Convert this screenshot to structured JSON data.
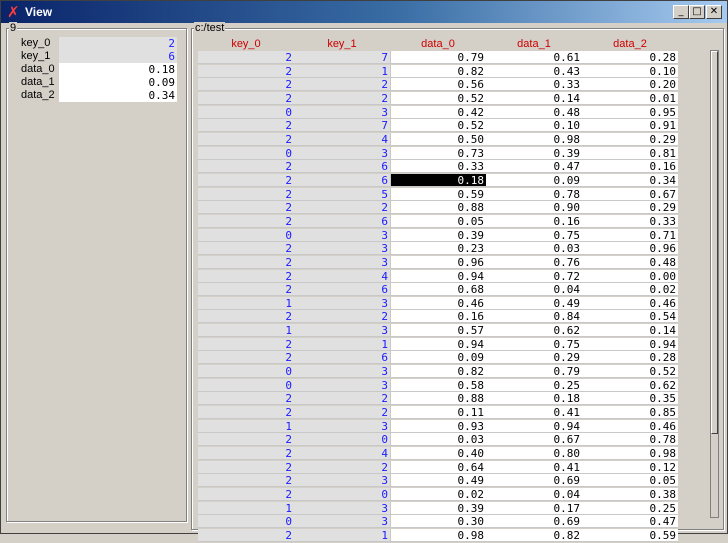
{
  "window": {
    "title": "View",
    "icon": "x-logo-icon",
    "controls": [
      "minimize",
      "maximize",
      "close"
    ]
  },
  "left_panel": {
    "label": "9",
    "properties": [
      {
        "name": "key_0",
        "value": "2",
        "kind": "key"
      },
      {
        "name": "key_1",
        "value": "6",
        "kind": "key"
      },
      {
        "name": "data_0",
        "value": "0.18",
        "kind": "data"
      },
      {
        "name": "data_1",
        "value": "0.09",
        "kind": "data"
      },
      {
        "name": "data_2",
        "value": "0.34",
        "kind": "data"
      }
    ]
  },
  "table": {
    "label": "c:/test",
    "columns": [
      "key_0",
      "key_1",
      "data_0",
      "data_1",
      "data_2"
    ],
    "selected_row": 9,
    "rows": [
      [
        "2",
        "7",
        "0.79",
        "0.61",
        "0.28"
      ],
      [
        "2",
        "1",
        "0.82",
        "0.43",
        "0.10"
      ],
      [
        "2",
        "2",
        "0.56",
        "0.33",
        "0.20"
      ],
      [
        "2",
        "2",
        "0.52",
        "0.14",
        "0.01"
      ],
      [
        "0",
        "3",
        "0.42",
        "0.48",
        "0.95"
      ],
      [
        "2",
        "7",
        "0.52",
        "0.10",
        "0.91"
      ],
      [
        "2",
        "4",
        "0.50",
        "0.98",
        "0.29"
      ],
      [
        "0",
        "3",
        "0.73",
        "0.39",
        "0.81"
      ],
      [
        "2",
        "6",
        "0.33",
        "0.47",
        "0.16"
      ],
      [
        "2",
        "6",
        "0.18",
        "0.09",
        "0.34"
      ],
      [
        "2",
        "5",
        "0.59",
        "0.78",
        "0.67"
      ],
      [
        "2",
        "2",
        "0.88",
        "0.90",
        "0.29"
      ],
      [
        "2",
        "6",
        "0.05",
        "0.16",
        "0.33"
      ],
      [
        "0",
        "3",
        "0.39",
        "0.75",
        "0.71"
      ],
      [
        "2",
        "3",
        "0.23",
        "0.03",
        "0.96"
      ],
      [
        "2",
        "3",
        "0.96",
        "0.76",
        "0.48"
      ],
      [
        "2",
        "4",
        "0.94",
        "0.72",
        "0.00"
      ],
      [
        "2",
        "6",
        "0.68",
        "0.04",
        "0.02"
      ],
      [
        "1",
        "3",
        "0.46",
        "0.49",
        "0.46"
      ],
      [
        "2",
        "2",
        "0.16",
        "0.84",
        "0.54"
      ],
      [
        "1",
        "3",
        "0.57",
        "0.62",
        "0.14"
      ],
      [
        "2",
        "1",
        "0.94",
        "0.75",
        "0.94"
      ],
      [
        "2",
        "6",
        "0.09",
        "0.29",
        "0.28"
      ],
      [
        "0",
        "3",
        "0.82",
        "0.79",
        "0.52"
      ],
      [
        "0",
        "3",
        "0.58",
        "0.25",
        "0.62"
      ],
      [
        "2",
        "2",
        "0.88",
        "0.18",
        "0.35"
      ],
      [
        "2",
        "2",
        "0.11",
        "0.41",
        "0.85"
      ],
      [
        "1",
        "3",
        "0.93",
        "0.94",
        "0.46"
      ],
      [
        "2",
        "0",
        "0.03",
        "0.67",
        "0.78"
      ],
      [
        "2",
        "4",
        "0.40",
        "0.80",
        "0.98"
      ],
      [
        "2",
        "2",
        "0.64",
        "0.41",
        "0.12"
      ],
      [
        "2",
        "3",
        "0.49",
        "0.69",
        "0.05"
      ],
      [
        "2",
        "0",
        "0.02",
        "0.04",
        "0.38"
      ],
      [
        "1",
        "3",
        "0.39",
        "0.17",
        "0.25"
      ],
      [
        "0",
        "3",
        "0.30",
        "0.69",
        "0.47"
      ],
      [
        "2",
        "1",
        "0.98",
        "0.82",
        "0.59"
      ]
    ]
  }
}
